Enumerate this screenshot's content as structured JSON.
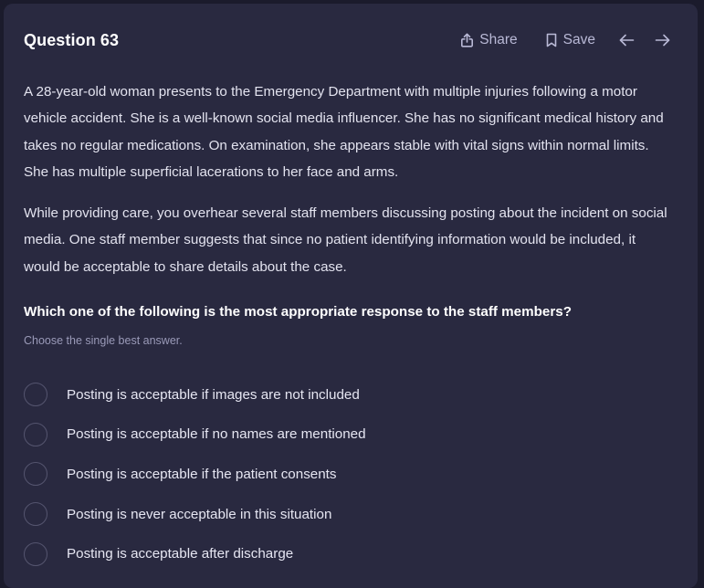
{
  "header": {
    "title": "Question 63",
    "share_label": "Share",
    "save_label": "Save"
  },
  "stem": {
    "paragraphs": [
      "A 28-year-old woman presents to the Emergency Department with multiple injuries following a motor vehicle accident. She is a well-known social media influencer. She has no significant medical history and takes no regular medications. On examination, she appears stable with vital signs within normal limits. She has multiple superficial lacerations to her face and arms.",
      "While providing care, you overhear several staff members discussing posting about the incident on social media. One staff member suggests that since no patient identifying information would be included, it would be acceptable to share details about the case."
    ]
  },
  "question": {
    "text": "Which one of the following is the most appropriate response to the staff members?",
    "instruction": "Choose the single best answer."
  },
  "options": [
    {
      "label": "Posting is acceptable if images are not included"
    },
    {
      "label": "Posting is acceptable if no names are mentioned"
    },
    {
      "label": "Posting is acceptable if the patient consents"
    },
    {
      "label": "Posting is never acceptable in this situation"
    },
    {
      "label": "Posting is acceptable after discharge"
    }
  ],
  "icons": {
    "share": "share-icon",
    "save": "bookmark-icon",
    "prev": "arrow-left-icon",
    "next": "arrow-right-icon"
  },
  "colors": {
    "background": "#1b1b2c",
    "card": "#292940",
    "text": "#e3e3ef",
    "muted": "#9a9ab8",
    "radio_border": "#55556f"
  }
}
